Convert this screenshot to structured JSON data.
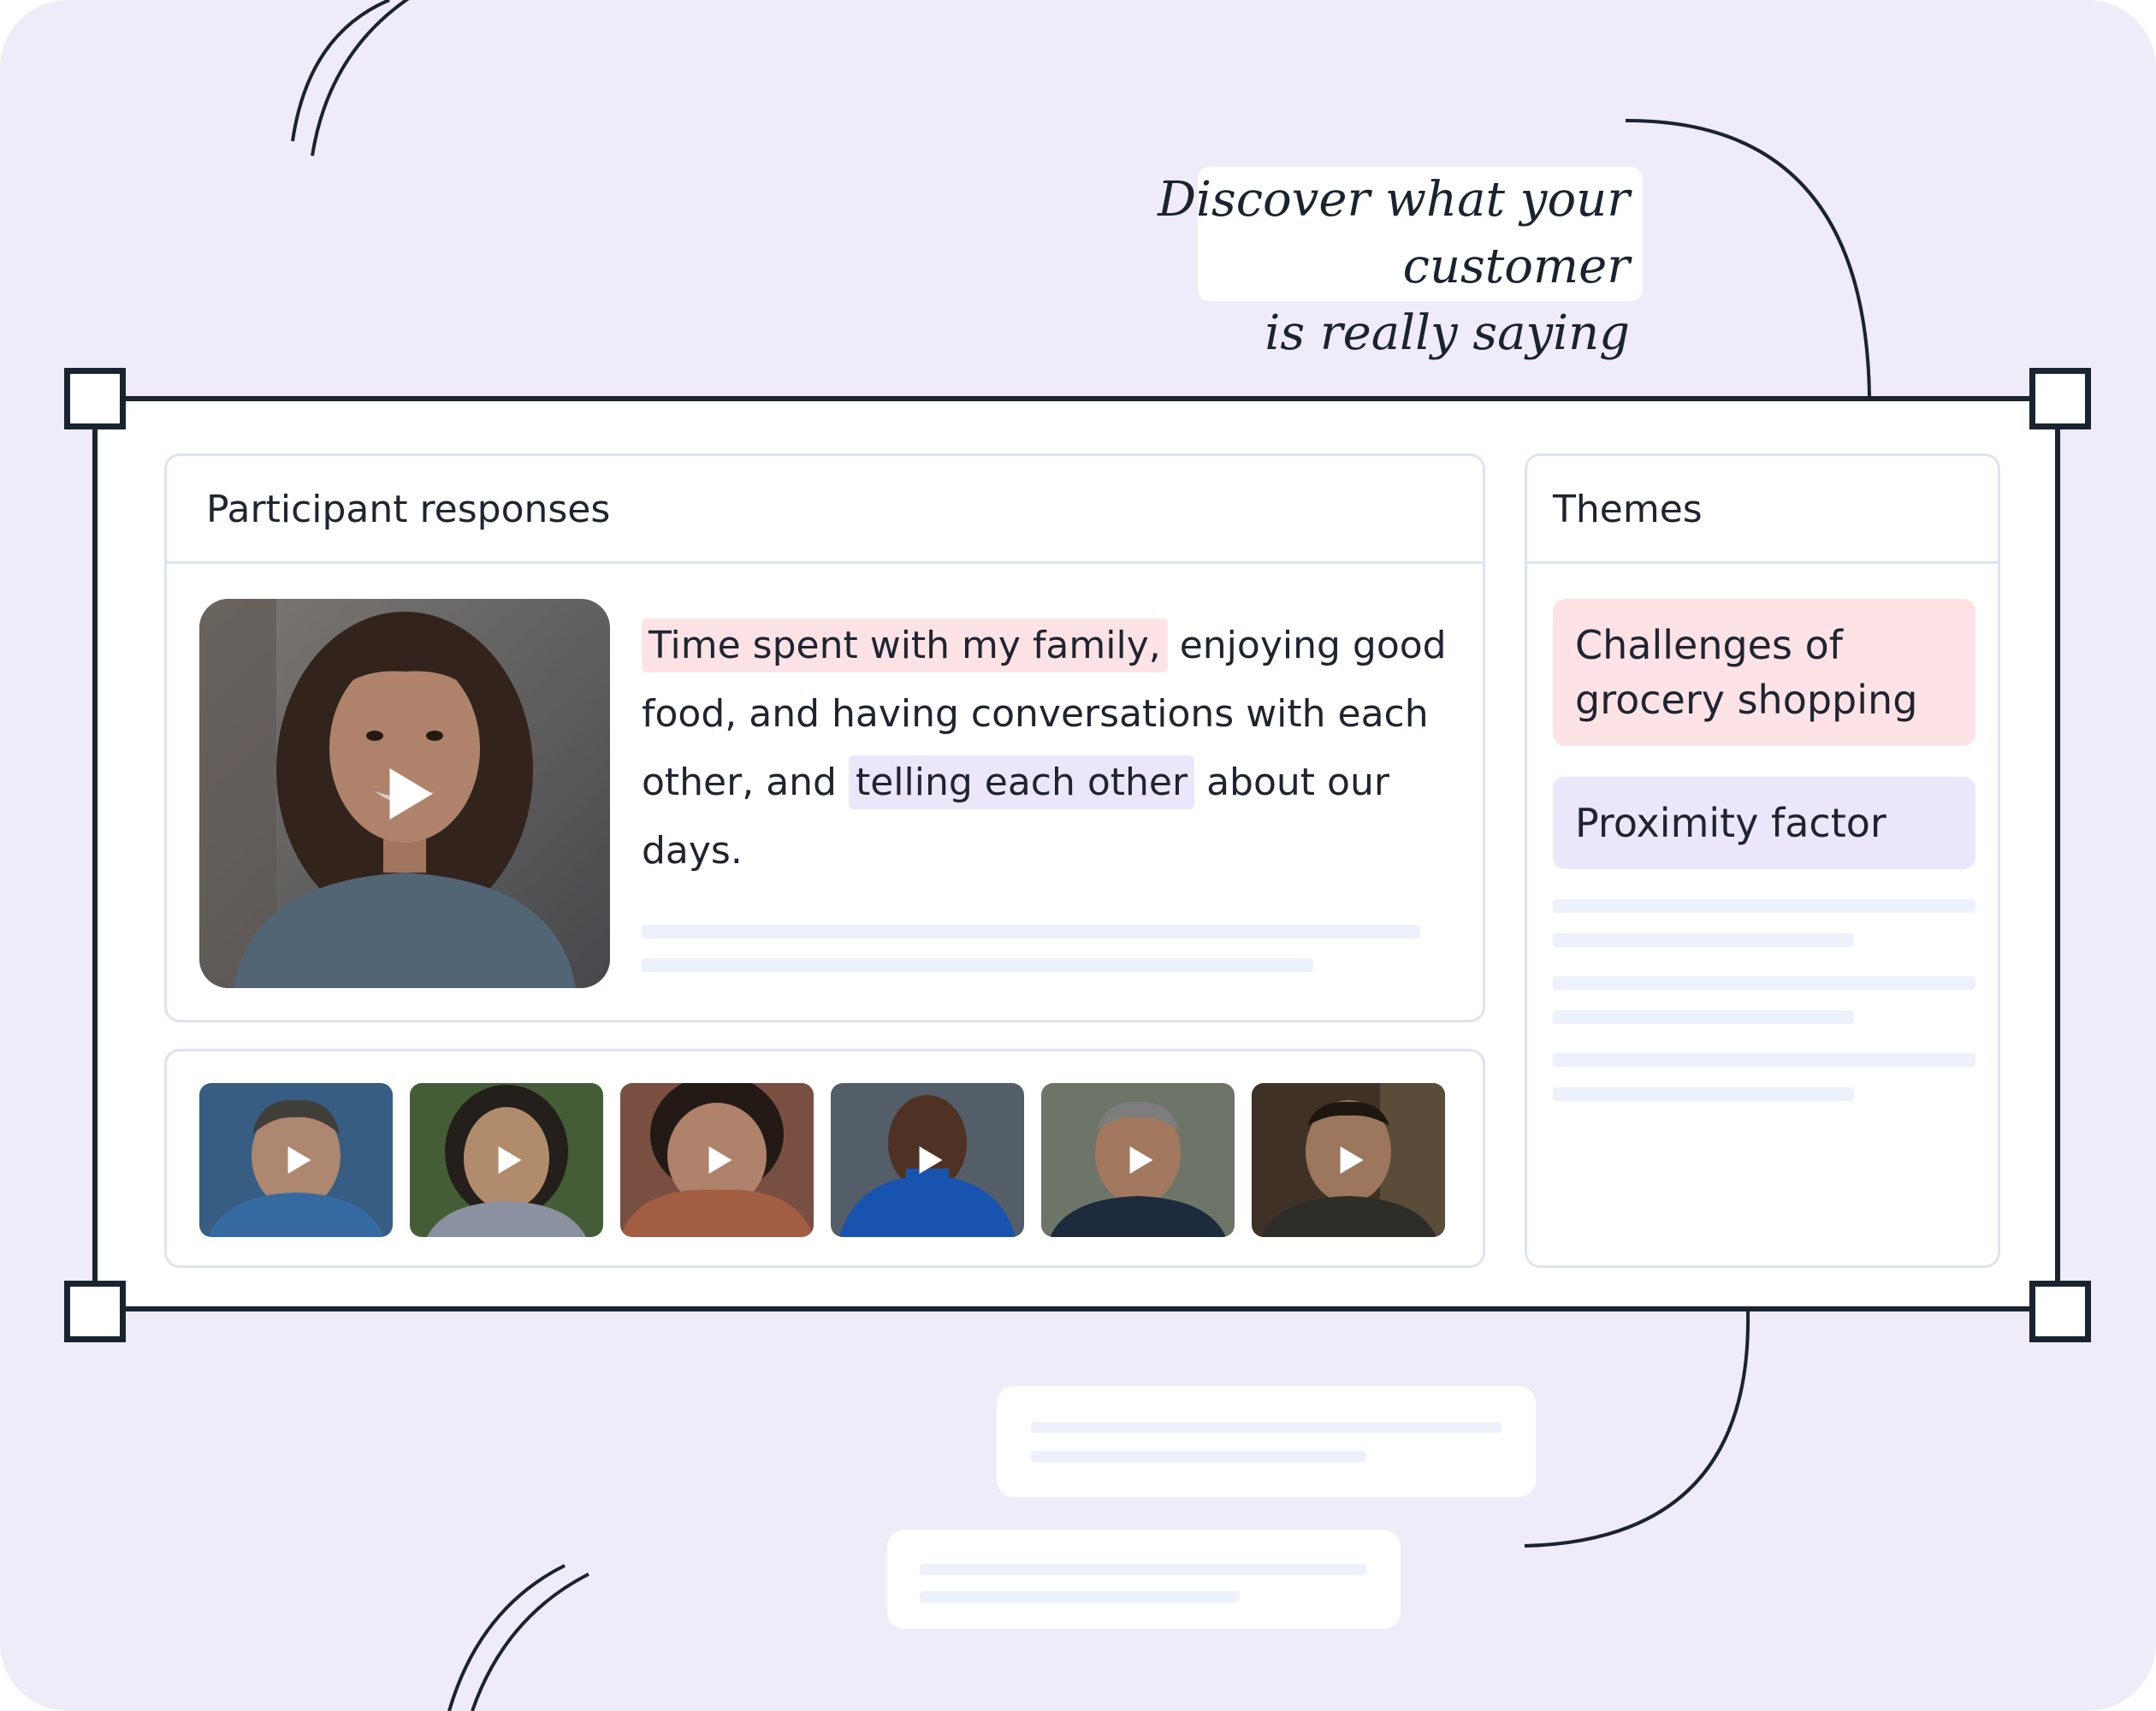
{
  "tagline": {
    "line1": "Discover what your customer",
    "line2": "is really saying"
  },
  "responses_panel": {
    "title": "Participant responses",
    "quote": {
      "highlight1": "Time spent with my family,",
      "part1": " enjoying good food, and having conversations with each other, and ",
      "highlight2": "telling each other",
      "part2": " about our days."
    },
    "main_video_icon": "play-icon"
  },
  "participant_videos": [
    {
      "name": "participant-video-1",
      "tone": "#3f6a95",
      "icon": "play-icon"
    },
    {
      "name": "participant-video-2",
      "tone": "#4f6a3e",
      "icon": "play-icon"
    },
    {
      "name": "participant-video-3",
      "tone": "#8a5a4a",
      "icon": "play-icon"
    },
    {
      "name": "participant-video-4",
      "tone": "#1c5fc9",
      "icon": "play-icon"
    },
    {
      "name": "participant-video-5",
      "tone": "#5b6a7a",
      "icon": "play-icon"
    },
    {
      "name": "participant-video-6",
      "tone": "#3a3a34",
      "icon": "play-icon"
    }
  ],
  "themes_panel": {
    "title": "Themes",
    "items": [
      {
        "label": "Challenges of grocery shopping",
        "color": "#fde3e6"
      },
      {
        "label": "Proximity factor",
        "color": "#ece6fb"
      }
    ]
  },
  "colors": {
    "background": "#efebf8",
    "frame": "#1a2330",
    "highlight_pink": "#fde3e6",
    "highlight_lilac": "#ece6fb",
    "placeholder_line": "#edf1fb"
  }
}
